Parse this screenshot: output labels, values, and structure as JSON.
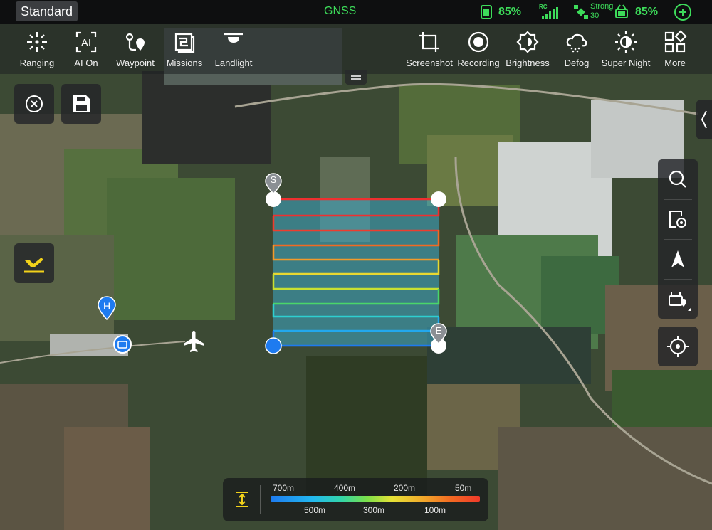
{
  "status_bar": {
    "mode": "Standard",
    "positioning": "GNSS",
    "aircraft_battery": "85%",
    "rc_label": "RC",
    "signal_strength_label": "Strong",
    "signal_value": "30",
    "rc_battery": "85%",
    "accent_color": "#3ddc5a"
  },
  "toolbar": {
    "left": [
      {
        "label": "Ranging",
        "icon": "ranging-icon"
      },
      {
        "label": "AI On",
        "icon": "ai-icon"
      },
      {
        "label": "Waypoint",
        "icon": "waypoint-icon"
      },
      {
        "label": "Missions",
        "icon": "missions-icon"
      },
      {
        "label": "Landlight",
        "icon": "landlight-icon"
      }
    ],
    "right": [
      {
        "label": "Screenshot",
        "icon": "screenshot-icon"
      },
      {
        "label": "Recording",
        "icon": "record-icon"
      },
      {
        "label": "Brightness",
        "icon": "brightness-icon"
      },
      {
        "label": "Defog",
        "icon": "defog-icon"
      },
      {
        "label": "Super Night",
        "icon": "super-night-icon"
      },
      {
        "label": "More",
        "icon": "more-grid-icon"
      }
    ]
  },
  "map": {
    "start_marker": "S",
    "end_marker": "E",
    "home_marker": "H"
  },
  "legend": {
    "top_ticks": [
      "700m",
      "400m",
      "200m",
      "50m"
    ],
    "bottom_ticks": [
      "500m",
      "300m",
      "100m"
    ]
  }
}
